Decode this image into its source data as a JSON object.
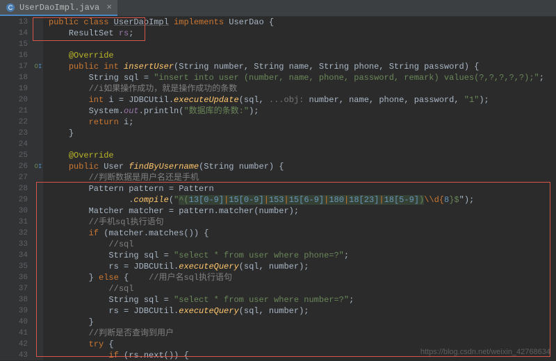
{
  "tab": {
    "label": "UserDaoImpl.java",
    "icon": "java-class-icon",
    "close": "×"
  },
  "gutter": {
    "start": 13,
    "end": 43,
    "markers": {
      "17": "OI",
      "26": "OI"
    }
  },
  "code": {
    "l13": {
      "k1": "public class",
      "name": "UserDaoImpl",
      "k2": "implements",
      "iface": "UserDao",
      "brace": " {"
    },
    "l14": {
      "type": "ResultSet",
      "var": "rs",
      "semi": ";"
    },
    "l16": {
      "ann": "@Override"
    },
    "l17": {
      "k1": "public int",
      "name": "insertUser",
      "params": "(String number, String name, String phone, String password) {"
    },
    "l18": {
      "decl": "String sql = ",
      "str": "\"insert into user (number, name, phone, password, remark) values(?,?,?,?,?);\"",
      "semi": ";"
    },
    "l19": {
      "cmt": "//i如果操作成功，就是操作成功的条数"
    },
    "l20": {
      "k1": "int",
      "var": "i",
      "eq": " = JDBCUtil.",
      "mtd": "executeUpdate",
      "open": "(sql, ",
      "hint": "...obj: ",
      "args": "number, name, phone, password, ",
      "one": "\"1\"",
      "close": ");"
    },
    "l21": {
      "pref": "System.",
      "out": "out",
      "print": ".println(",
      "str": "\"数据库的条数:\"",
      "close": ");"
    },
    "l22": {
      "ret": "return",
      "sp": " ",
      "var": "i",
      "semi": ";"
    },
    "l23": {
      "brace": "}"
    },
    "l25": {
      "ann": "@Override"
    },
    "l26": {
      "k1": "public",
      "ret": " User ",
      "name": "findByUsername",
      "params": "(String number) {"
    },
    "l27": {
      "cmt": "//判断数据是用户名还是手机"
    },
    "l28": {
      "txt": "Pattern pattern = Pattern"
    },
    "l29": {
      "pref": "        .",
      "mtd": "compile",
      "open": "(",
      "q": "\"",
      "r1": "^(",
      "r2": "13[0-9]",
      "pipe1": "|",
      "r3": "15[0-9]",
      "pipe2": "|",
      "r4": "153",
      "pipe3": "|",
      "r5": "15[6-9]",
      "pipe4": "|",
      "r6": "180",
      "pipe5": "|",
      "r7": "18[23]",
      "pipe6": "|",
      "r8": "18[5-9]",
      "r9": ")",
      "esc": "\\\\d{",
      "eight": "8",
      "tail": "}$",
      "close": "\");"
    },
    "l30": {
      "txt": "Matcher matcher = pattern.matcher(number);"
    },
    "l31": {
      "cmt": "//手机sql执行语句"
    },
    "l32": {
      "k1": "if",
      "rest": " (matcher.matches()) {"
    },
    "l33": {
      "cmt": "//sql"
    },
    "l34": {
      "decl": "String sql = ",
      "str": "\"select * from user where phone=?\"",
      "semi": ";"
    },
    "l35": {
      "pref": "rs = JDBCUtil.",
      "mtd": "executeQuery",
      "args": "(sql, number);"
    },
    "l36": {
      "brace": "} ",
      "k1": "else",
      "rest": " {    ",
      "cmt": "//用户名sql执行语句"
    },
    "l37": {
      "cmt": "//sql"
    },
    "l38": {
      "decl": "String sql = ",
      "str": "\"select * from user where number=?\"",
      "semi": ";"
    },
    "l39": {
      "pref": "rs = JDBCUtil.",
      "mtd": "executeQuery",
      "args": "(sql, number);"
    },
    "l40": {
      "brace": "}"
    },
    "l41": {
      "cmt": "//判断是否查询到用户"
    },
    "l42": {
      "k1": "try",
      "rest": " {"
    },
    "l43": {
      "k1": "if",
      "rest": " (rs.next()) {"
    }
  },
  "watermark": "https://blog.csdn.net/weixin_42768634"
}
